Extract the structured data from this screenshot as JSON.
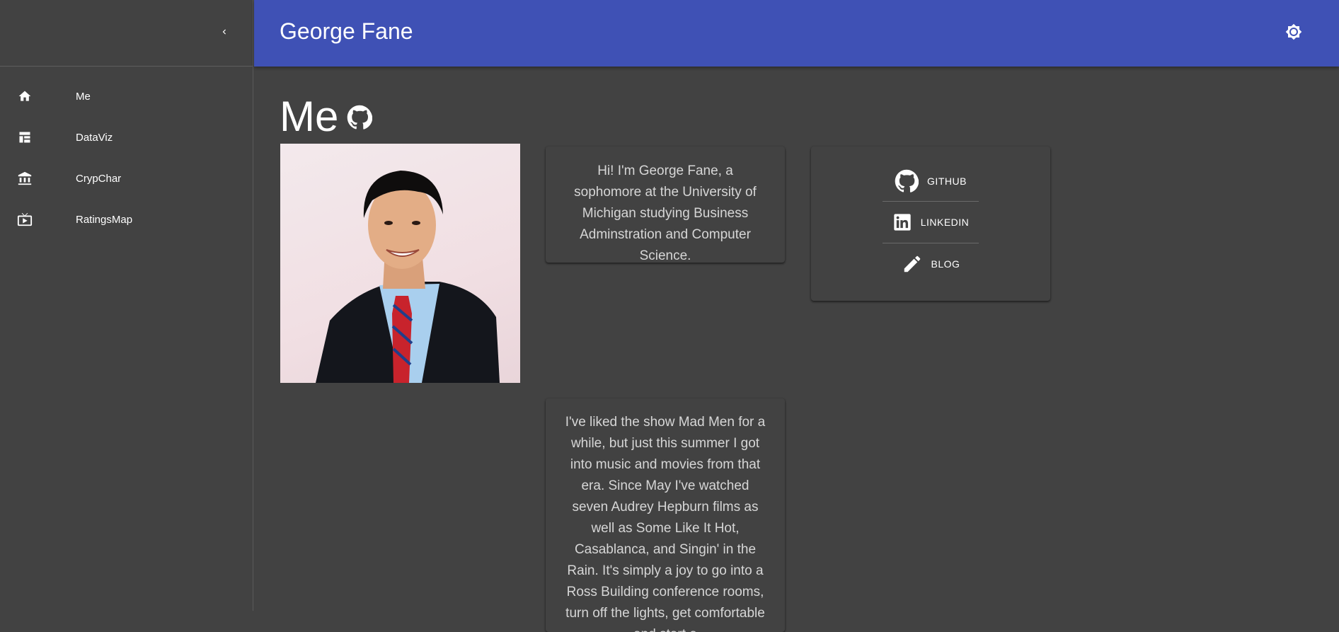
{
  "sidebar": {
    "collapse_icon": "chevron-left-icon",
    "items": [
      {
        "label": "Me",
        "icon": "home-icon"
      },
      {
        "label": "DataViz",
        "icon": "table-icon"
      },
      {
        "label": "CrypChar",
        "icon": "bank-icon"
      },
      {
        "label": "RatingsMap",
        "icon": "tv-play-icon"
      }
    ]
  },
  "appbar": {
    "title": "George Fane",
    "theme_icon": "brightness-icon",
    "color": "#3f51b5"
  },
  "main": {
    "title": "Me",
    "title_icon": "github-icon",
    "photo_alt": "George Fane portrait",
    "intro": "Hi! I'm George Fane, a sophomore at the University of Michigan studying Business Adminstration and Computer Science.",
    "links": [
      {
        "label": "GITHUB",
        "icon": "github-icon"
      },
      {
        "label": "LINKEDIN",
        "icon": "linkedin-icon"
      },
      {
        "label": "BLOG",
        "icon": "pencil-icon"
      }
    ],
    "bio": "I've liked the show Mad Men for a while, but just this summer I got into music and movies from that era. Since May I've watched seven Audrey Hepburn films as well as Some Like It Hot, Casablanca, and Singin' in the Rain. It's simply a joy to go into a Ross Building conference rooms, turn off the lights, get comfortable and start a"
  }
}
